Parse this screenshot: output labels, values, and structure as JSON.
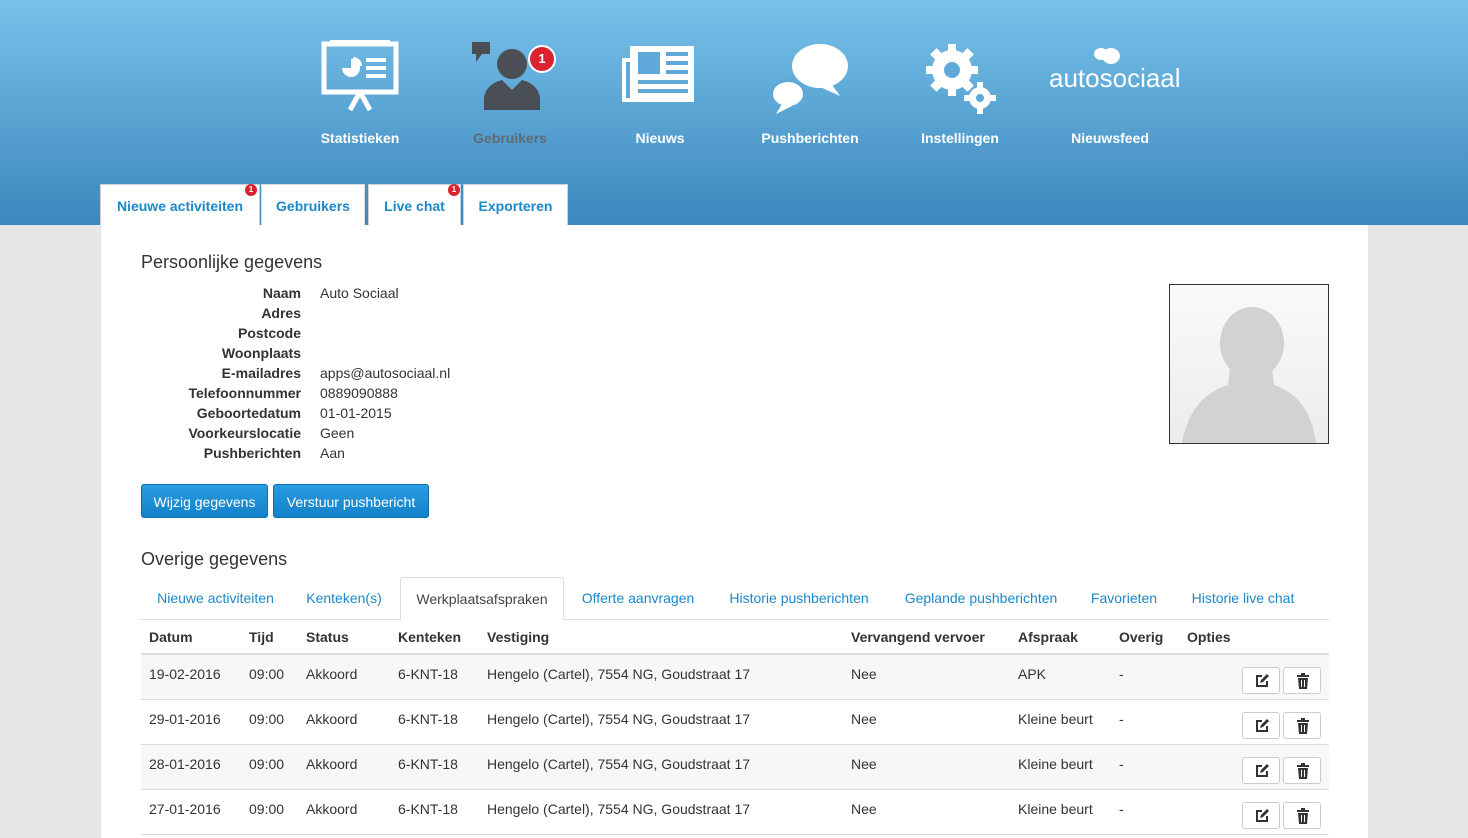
{
  "nav": {
    "items": [
      {
        "label": "Statistieken",
        "icon": "presentation-icon"
      },
      {
        "label": "Gebruikers",
        "icon": "user-icon",
        "badge": "1"
      },
      {
        "label": "Nieuws",
        "icon": "newspaper-icon"
      },
      {
        "label": "Pushberichten",
        "icon": "chat-bubbles-icon"
      },
      {
        "label": "Instellingen",
        "icon": "gears-icon"
      },
      {
        "label": "Nieuwsfeed",
        "icon": "autosociaal-logo",
        "logo_text": "autosociaal"
      }
    ]
  },
  "top_tabs": [
    {
      "label": "Nieuwe activiteiten",
      "badge": "1"
    },
    {
      "label": "Gebruikers"
    },
    {
      "label": "Live chat",
      "badge": "1"
    },
    {
      "label": "Exporteren"
    }
  ],
  "personal": {
    "title": "Persoonlijke gegevens",
    "fields": [
      {
        "label": "Naam",
        "value": "Auto Sociaal"
      },
      {
        "label": "Adres",
        "value": ""
      },
      {
        "label": "Postcode",
        "value": ""
      },
      {
        "label": "Woonplaats",
        "value": ""
      },
      {
        "label": "E-mailadres",
        "value": "apps@autosociaal.nl"
      },
      {
        "label": "Telefoonnummer",
        "value": "0889090888"
      },
      {
        "label": "Geboortedatum",
        "value": "01-01-2015"
      },
      {
        "label": "Voorkeurslocatie",
        "value": "Geen"
      },
      {
        "label": "Pushberichten",
        "value": "Aan"
      }
    ],
    "edit_button": "Wijzig gegevens",
    "push_button": "Verstuur pushbericht"
  },
  "other": {
    "title": "Overige gegevens",
    "tabs": [
      "Nieuwe activiteiten",
      "Kenteken(s)",
      "Werkplaatsafspraken",
      "Offerte aanvragen",
      "Historie pushberichten",
      "Geplande pushberichten",
      "Favorieten",
      "Historie live chat"
    ],
    "active_tab": "Werkplaatsafspraken"
  },
  "table": {
    "headers": [
      "Datum",
      "Tijd",
      "Status",
      "Kenteken",
      "Vestiging",
      "Vervangend vervoer",
      "Afspraak",
      "Overig",
      "Opties"
    ],
    "rows": [
      [
        "19-02-2016",
        "09:00",
        "Akkoord",
        "6-KNT-18",
        "Hengelo (Cartel), 7554 NG, Goudstraat 17",
        "Nee",
        "APK",
        "-"
      ],
      [
        "29-01-2016",
        "09:00",
        "Akkoord",
        "6-KNT-18",
        "Hengelo (Cartel), 7554 NG, Goudstraat 17",
        "Nee",
        "Kleine beurt",
        "-"
      ],
      [
        "28-01-2016",
        "09:00",
        "Akkoord",
        "6-KNT-18",
        "Hengelo (Cartel), 7554 NG, Goudstraat 17",
        "Nee",
        "Kleine beurt",
        "-"
      ],
      [
        "27-01-2016",
        "09:00",
        "Akkoord",
        "6-KNT-18",
        "Hengelo (Cartel), 7554 NG, Goudstraat 17",
        "Nee",
        "Kleine beurt",
        "-"
      ]
    ]
  },
  "colors": {
    "header_top": "#78c1ea",
    "header_bottom": "#3c88bd",
    "accent": "#1a88c9",
    "badge": "#d9232e"
  }
}
